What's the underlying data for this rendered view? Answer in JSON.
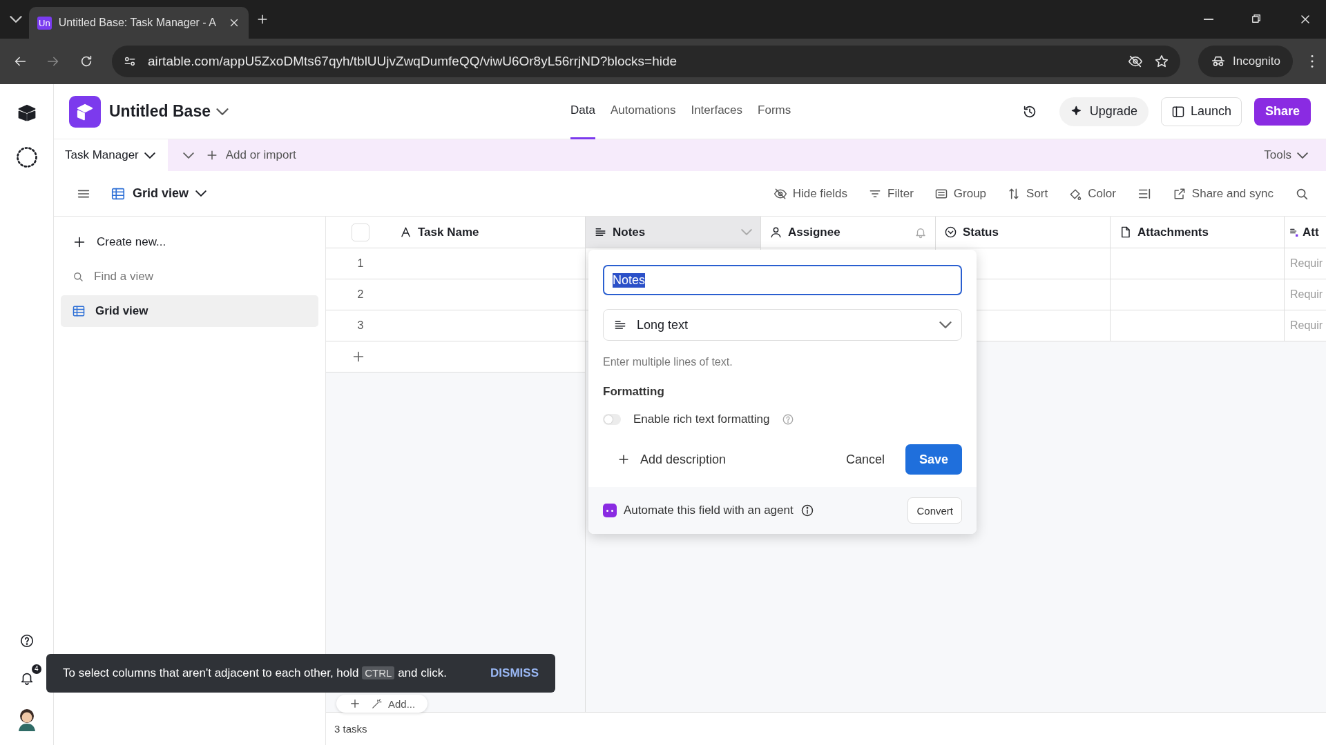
{
  "browser": {
    "favicon": "Un",
    "tab_title": "Untitled Base: Task Manager - A",
    "url": "airtable.com/appU5ZxoDMts67qyh/tblUUjvZwqDumfeQQ/viwU6Or8yL56rrjND?blocks=hide",
    "incognito": "Incognito"
  },
  "rail": {
    "notifications": "4"
  },
  "header": {
    "base_name": "Untitled Base",
    "nav": [
      {
        "label": "Data",
        "selected": true
      },
      {
        "label": "Automations",
        "selected": false
      },
      {
        "label": "Interfaces",
        "selected": false
      },
      {
        "label": "Forms",
        "selected": false
      }
    ],
    "upgrade": "Upgrade",
    "launch": "Launch",
    "share": "Share"
  },
  "table_tabs": {
    "tables": [
      {
        "label": "Task Manager",
        "selected": true
      }
    ],
    "add": "Add or import",
    "tools": "Tools"
  },
  "view_bar": {
    "view": "Grid view",
    "actions": [
      {
        "kind": "hide",
        "label": "Hide fields"
      },
      {
        "kind": "filter",
        "label": "Filter"
      },
      {
        "kind": "group",
        "label": "Group"
      },
      {
        "kind": "sort",
        "label": "Sort"
      },
      {
        "kind": "color",
        "label": "Color"
      },
      {
        "kind": "height"
      },
      {
        "kind": "share",
        "label": "Share and sync"
      },
      {
        "kind": "search"
      }
    ]
  },
  "sidebar": {
    "create": "Create new...",
    "search_placeholder": "Find a view",
    "views": [
      {
        "label": "Grid view",
        "selected": true
      }
    ]
  },
  "grid": {
    "columns": [
      {
        "kind": "text",
        "label": "Task Name",
        "editing": false
      },
      {
        "kind": "long_text",
        "label": "Notes",
        "editing": true
      },
      {
        "kind": "user",
        "label": "Assignee",
        "editing": false
      },
      {
        "kind": "select",
        "label": "Status",
        "editing": false
      },
      {
        "kind": "attachment",
        "label": "Attachments",
        "editing": false
      },
      {
        "kind": "ai_text",
        "label": "Att",
        "editing": false
      }
    ],
    "select_all_checked": false,
    "rows": [
      {
        "number": "1",
        "last_cell": "Requir"
      },
      {
        "number": "2",
        "last_cell": "Requir"
      },
      {
        "number": "3",
        "last_cell": "Requir"
      }
    ],
    "add_label": "Add...",
    "footer": "3 tasks"
  },
  "field_editor": {
    "name_value": "Notes",
    "type": "Long text",
    "description": "Enter multiple lines of text.",
    "section": "Formatting",
    "options": [
      {
        "label": "Enable rich text formatting",
        "on": false
      }
    ],
    "add_description": "Add description",
    "cancel": "Cancel",
    "save": "Save",
    "agent_text": "Automate this field with an agent",
    "convert": "Convert"
  },
  "toast": {
    "text_before": "To select columns that aren't adjacent to each other, hold",
    "key": "CTRL",
    "text_after": "and click.",
    "action": "DISMISS"
  }
}
